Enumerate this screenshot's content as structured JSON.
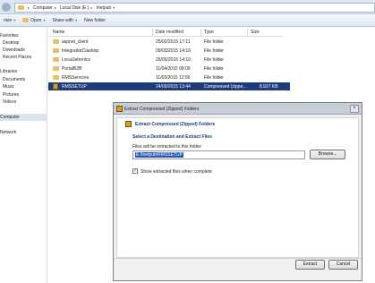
{
  "address": {
    "crumbs": [
      "Computer",
      "Local Disk (E:)",
      "Inetpub"
    ]
  },
  "toolbar": {
    "organize": "nize",
    "open": "Open",
    "share_with": "Share with",
    "new_folder": "New folder"
  },
  "nav": {
    "items": [
      "Favorites",
      "Desktop",
      "Downloads",
      "Recent Places",
      "Libraries",
      "Documents",
      "Music",
      "Pictures",
      "Videos",
      "Computer",
      "Network"
    ]
  },
  "columns": {
    "name": "Name",
    "date": "Date modified",
    "type": "Type",
    "size": "Size"
  },
  "files": [
    {
      "name": "aspnet_client",
      "date": "25/02/2015 17:11",
      "type": "File folder",
      "size": ""
    },
    {
      "name": "IntegradorCiashop",
      "date": "09/03/2015 14:16",
      "type": "File folder",
      "size": ""
    },
    {
      "name": "LocalJetronics",
      "date": "26/05/2015 14:10",
      "type": "File folder",
      "size": ""
    },
    {
      "name": "PortalB2B",
      "date": "11/04/2015 08:09",
      "type": "File folder",
      "size": ""
    },
    {
      "name": "RMSServices",
      "date": "11/03/2015 12:55",
      "type": "File folder",
      "size": ""
    },
    {
      "name": "RMSSETUP",
      "date": "24/09/2015 13:44",
      "type": "Compressed (zippe...",
      "size": "8.927 KB"
    }
  ],
  "dialog": {
    "window_title": "Extract Compressed (Zipped) Folders",
    "heading": "Extract Compressed (Zipped) Folders",
    "subheading": "Select a Destination and Extract Files",
    "path_label": "Files will be extracted to this folder:",
    "path_value": "E:\\Inetpub\\RMSSETUP",
    "browse": "Browse...",
    "show_files": "Show extracted files when complete",
    "show_files_checked": true,
    "extract": "Extract",
    "cancel": "Cancel"
  }
}
